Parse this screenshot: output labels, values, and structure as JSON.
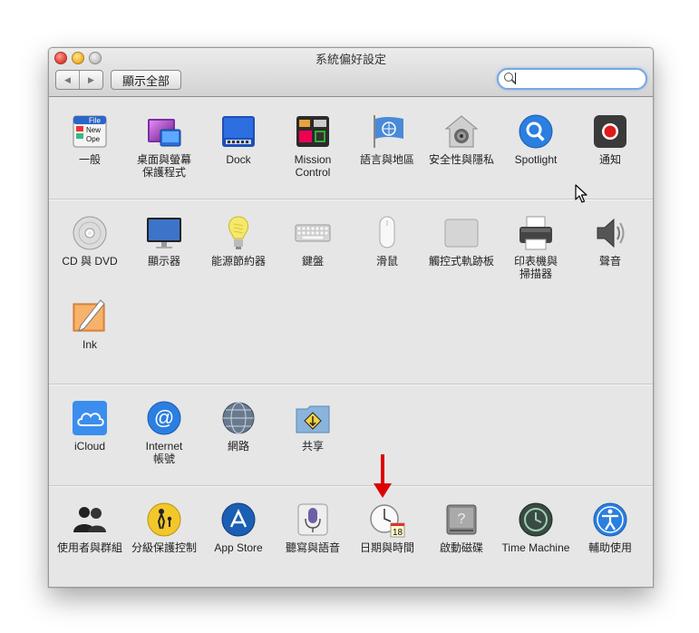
{
  "window": {
    "title": "系統偏好設定",
    "nav_back": "◀",
    "nav_forward": "▶",
    "show_all": "顯示全部",
    "search_value": ""
  },
  "sections": [
    {
      "items": [
        {
          "label": "一般",
          "icon": "file-icon"
        },
        {
          "label": "桌面與螢幕\n保護程式",
          "icon": "desktop-icon"
        },
        {
          "label": "Dock",
          "icon": "dock-icon"
        },
        {
          "label": "Mission\nControl",
          "icon": "mission-control-icon"
        },
        {
          "label": "語言與地區",
          "icon": "flag-icon"
        },
        {
          "label": "安全性與隱私",
          "icon": "house-lock-icon"
        },
        {
          "label": "Spotlight",
          "icon": "magnifier-icon"
        },
        {
          "label": "通知",
          "icon": "notification-icon"
        }
      ]
    },
    {
      "items": [
        {
          "label": "CD 與 DVD",
          "icon": "disc-icon"
        },
        {
          "label": "顯示器",
          "icon": "monitor-icon"
        },
        {
          "label": "能源節約器",
          "icon": "bulb-icon"
        },
        {
          "label": "鍵盤",
          "icon": "keyboard-icon"
        },
        {
          "label": "滑鼠",
          "icon": "mouse-icon"
        },
        {
          "label": "觸控式軌跡板",
          "icon": "trackpad-icon"
        },
        {
          "label": "印表機與\n掃描器",
          "icon": "printer-icon"
        },
        {
          "label": "聲音",
          "icon": "speaker-icon"
        },
        {
          "label": "Ink",
          "icon": "ink-pen-icon"
        }
      ]
    },
    {
      "items": [
        {
          "label": "iCloud",
          "icon": "cloud-icon"
        },
        {
          "label": "Internet\n帳號",
          "icon": "at-icon"
        },
        {
          "label": "網路",
          "icon": "globe-icon"
        },
        {
          "label": "共享",
          "icon": "shared-folder-icon"
        }
      ]
    },
    {
      "items": [
        {
          "label": "使用者與群組",
          "icon": "users-icon"
        },
        {
          "label": "分級保護控制",
          "icon": "parental-icon"
        },
        {
          "label": "App Store",
          "icon": "app-store-icon"
        },
        {
          "label": "聽寫與語音",
          "icon": "microphone-icon"
        },
        {
          "label": "日期與時間",
          "icon": "clock-calendar-icon"
        },
        {
          "label": "啟動磁碟",
          "icon": "hard-drive-icon"
        },
        {
          "label": "Time Machine",
          "icon": "time-machine-icon"
        },
        {
          "label": "輔助使用",
          "icon": "accessibility-icon"
        }
      ]
    }
  ],
  "calendar_day": "18"
}
